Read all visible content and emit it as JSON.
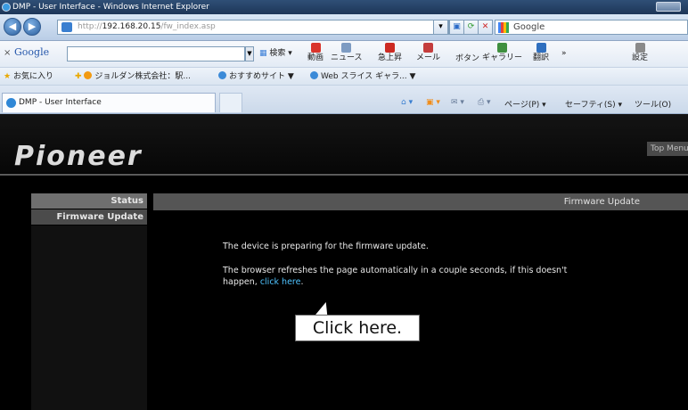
{
  "window": {
    "title": "DMP - User Interface - Windows Internet Explorer"
  },
  "address": {
    "url_prefix": "http://",
    "url_host": "192.168.20.15",
    "url_path": "/fw_index.asp",
    "search_engine": "Google"
  },
  "google_toolbar": {
    "close": "×",
    "label": "Google",
    "search_value": "",
    "items": [
      "検索",
      "動画",
      "ニュース",
      "急上昇",
      "メール",
      "ボタン",
      "ギャラリー",
      "翻訳",
      "»",
      "設定"
    ],
    "icon_colors": [
      "#3b7fd8",
      "#d9342b",
      "#7d9bc2",
      "#cc2a22",
      "#c43d3d",
      "#3f8f3f",
      "#2f6fbf",
      "#8a8a8a"
    ]
  },
  "favorites_bar": {
    "favorites": "お気に入り",
    "site1": "ジョルダン株式会社：駅...",
    "site2": "おすすめサイト ▼",
    "site3": "Web スライス ギャラ... ▼"
  },
  "tab": {
    "label": "DMP - User Interface"
  },
  "command_bar": {
    "page": "ページ(P) ▾",
    "safety": "セーフティ(S) ▾",
    "tools": "ツール(O)"
  },
  "page": {
    "logo": "Pioneer",
    "top_menu": "Top Menu",
    "sidebar": [
      "Status",
      "Firmware Update"
    ],
    "panel_title": "Firmware Update",
    "message_1": "The device is preparing for the firmware update.",
    "message_2a": "The browser refreshes the page automatically in a couple seconds, if this doesn't",
    "message_2b": "happen, ",
    "link": "click here",
    "period": "."
  },
  "callout": "Click here."
}
